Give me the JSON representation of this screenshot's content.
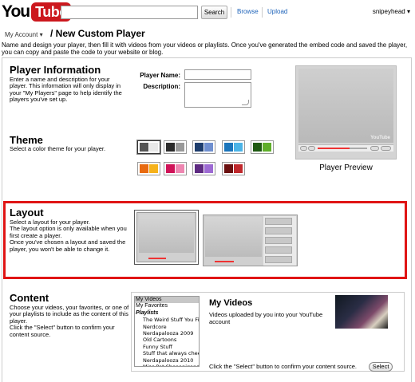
{
  "header": {
    "logo_you": "You",
    "logo_tube": "Tube",
    "search_button": "Search",
    "browse_link": "Browse",
    "upload_link": "Upload",
    "user_menu": "snipeyhead ▾"
  },
  "page": {
    "breadcrumb": "My Account ▾",
    "title": "/ New Custom Player",
    "intro": "Name and design your player, then fill it with videos from your videos or playlists. Once you've generated the embed code and saved the player, you can copy and paste the code to your website or blog."
  },
  "player_info": {
    "title": "Player Information",
    "desc": "Enter a name and description for your player. This information will only display in your \"My Players\" page to help identify the players you've set up.",
    "name_label": "Player Name:",
    "name_value": "",
    "description_label": "Description:",
    "description_value": ""
  },
  "preview": {
    "label": "Player Preview",
    "logo": "YouTube"
  },
  "theme": {
    "title": "Theme",
    "desc": "Select a color theme for your player.",
    "options": [
      [
        "#555555",
        "#e8e8e8"
      ],
      [
        "#2b2b2b",
        "#999999"
      ],
      [
        "#1e3d6d",
        "#6f8fcf"
      ],
      [
        "#1b75bb",
        "#4bb3e6"
      ],
      [
        "#1f5a12",
        "#5fae2a"
      ],
      [
        "#e86a10",
        "#f6b21b"
      ],
      [
        "#cf1358",
        "#ee86b1"
      ],
      [
        "#5e2a82",
        "#9d6ad3"
      ],
      [
        "#6b1010",
        "#c0282c"
      ]
    ]
  },
  "layout": {
    "title": "Layout",
    "desc_1": "Select a layout for your player.",
    "desc_2": "The layout option is only available when you first create a player.",
    "desc_3": "Once you've chosen a layout and saved the player, you won't be able to change it."
  },
  "content": {
    "title": "Content",
    "desc_1": "Choose your videos, your favorites, or one of your playlists to include as the content of this player.",
    "desc_2": "Click the \"Select\" button to confirm your content source.",
    "options": [
      {
        "label": "My Videos",
        "kind": "selected"
      },
      {
        "label": "My Favorites",
        "kind": "item"
      },
      {
        "label": "Playlists",
        "kind": "group"
      },
      {
        "label": "The Weird Stuff You Fir",
        "kind": "child"
      },
      {
        "label": "Nerdcore",
        "kind": "child"
      },
      {
        "label": "Nerdapalooza 2009",
        "kind": "child"
      },
      {
        "label": "Old Cartoons",
        "kind": "child"
      },
      {
        "label": "Funny Stuff",
        "kind": "child"
      },
      {
        "label": "Stuff that always cheer",
        "kind": "child"
      },
      {
        "label": "Nerdapalooza 2010",
        "kind": "child"
      },
      {
        "label": "Misc Pet Shenanigans",
        "kind": "child"
      }
    ],
    "heading": "My Videos",
    "text": "Videos uploaded by you into your YouTube account",
    "hint": "Click the \"Select\" button to confirm your content source.",
    "select_button": "Select"
  }
}
